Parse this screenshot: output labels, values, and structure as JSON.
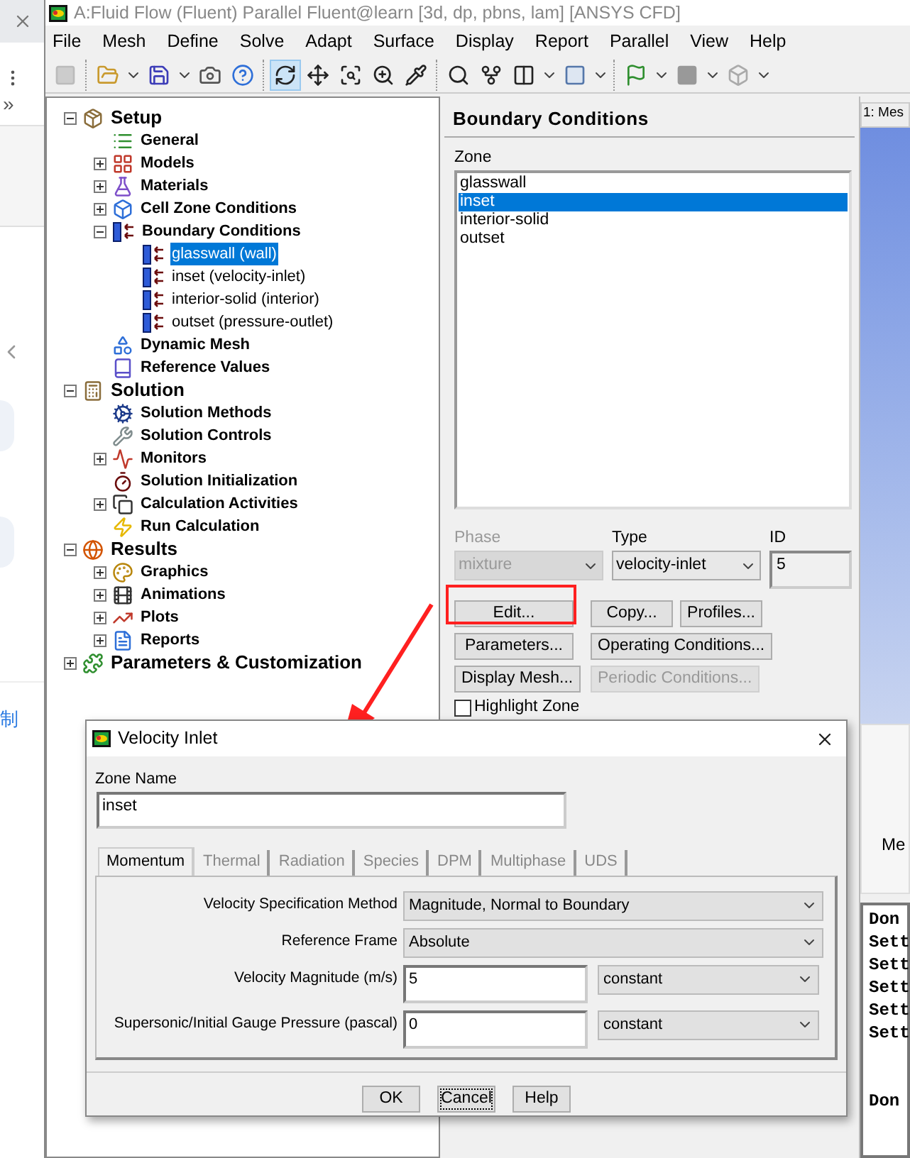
{
  "browser_strip": {
    "expand_glyph": "»",
    "link": "制"
  },
  "window": {
    "title": "A:Fluid Flow (Fluent) Parallel Fluent@learn  [3d, dp, pbns, lam] [ANSYS CFD]"
  },
  "menu": [
    "File",
    "Mesh",
    "Define",
    "Solve",
    "Adapt",
    "Surface",
    "Display",
    "Report",
    "Parallel",
    "View",
    "Help"
  ],
  "toolbar_tools": [
    {
      "selected": true
    },
    {
      "selected": false
    },
    {
      "selected": false
    },
    {
      "selected": false
    },
    {
      "selected": false
    }
  ],
  "tree": [
    {
      "label": "Setup",
      "kind": "heading",
      "selected": false,
      "expanded": true,
      "children": [
        {
          "label": "General",
          "selected": false
        },
        {
          "label": "Models",
          "selected": false,
          "expanded": false
        },
        {
          "label": "Materials",
          "selected": false,
          "expanded": false
        },
        {
          "label": "Cell Zone Conditions",
          "selected": false,
          "expanded": false
        },
        {
          "label": "Boundary Conditions",
          "selected": false,
          "expanded": true,
          "children": [
            {
              "label": "glasswall (wall)",
              "kind": "leaf",
              "selected": true
            },
            {
              "label": "inset (velocity-inlet)",
              "kind": "leaf",
              "selected": false
            },
            {
              "label": "interior-solid (interior)",
              "kind": "leaf",
              "selected": false
            },
            {
              "label": "outset (pressure-outlet)",
              "kind": "leaf",
              "selected": false
            }
          ]
        },
        {
          "label": "Dynamic Mesh",
          "selected": false
        },
        {
          "label": "Reference Values",
          "selected": false
        }
      ]
    },
    {
      "label": "Solution",
      "kind": "heading",
      "selected": false,
      "expanded": true,
      "children": [
        {
          "label": "Solution Methods",
          "selected": false
        },
        {
          "label": "Solution Controls",
          "selected": false
        },
        {
          "label": "Monitors",
          "selected": false,
          "expanded": false
        },
        {
          "label": "Solution Initialization",
          "selected": false
        },
        {
          "label": "Calculation Activities",
          "selected": false,
          "expanded": false
        },
        {
          "label": "Run Calculation",
          "selected": false
        }
      ]
    },
    {
      "label": "Results",
      "kind": "heading",
      "selected": false,
      "expanded": true,
      "children": [
        {
          "label": "Graphics",
          "selected": false,
          "expanded": false
        },
        {
          "label": "Animations",
          "selected": false,
          "expanded": false
        },
        {
          "label": "Plots",
          "selected": false,
          "expanded": false
        },
        {
          "label": "Reports",
          "selected": false,
          "expanded": false
        }
      ]
    },
    {
      "label": "Parameters & Customization",
      "kind": "heading",
      "selected": false,
      "expanded": false
    }
  ],
  "task_panel": {
    "title": "Boundary Conditions",
    "zone_label": "Zone",
    "zones": [
      {
        "label": "glasswall",
        "selected": false
      },
      {
        "label": "inset",
        "selected": true
      },
      {
        "label": "interior-solid",
        "selected": false
      },
      {
        "label": "outset",
        "selected": false
      }
    ],
    "phase": {
      "label": "Phase",
      "value": "mixture",
      "disabled": true
    },
    "type": {
      "label": "Type",
      "value": "velocity-inlet"
    },
    "id": {
      "label": "ID",
      "value": "5"
    },
    "buttons": [
      {
        "label": "Edit...",
        "disabled": false
      },
      {
        "label": "Copy...",
        "disabled": false
      },
      {
        "label": "Profiles...",
        "disabled": false
      },
      {
        "label": "Parameters...",
        "disabled": false
      },
      {
        "label": "Operating Conditions...",
        "disabled": false
      },
      {
        "label": "Display Mesh...",
        "disabled": false
      },
      {
        "label": "Periodic Conditions...",
        "disabled": true
      }
    ],
    "highlight_zone": {
      "label": "Highlight Zone",
      "checked": false
    }
  },
  "graphics": {
    "tab": "1: Mes",
    "label": "Me",
    "console": [
      "Don",
      "Sett",
      "Sett",
      "Sett",
      "Sett",
      "Sett",
      "Don"
    ]
  },
  "dialog": {
    "title": "Velocity Inlet",
    "zone_name_label": "Zone Name",
    "zone_name": "inset",
    "tabs": [
      {
        "label": "Momentum",
        "selected": true,
        "disabled": false
      },
      {
        "label": "Thermal",
        "selected": false,
        "disabled": true
      },
      {
        "label": "Radiation",
        "selected": false,
        "disabled": true
      },
      {
        "label": "Species",
        "selected": false,
        "disabled": true
      },
      {
        "label": "DPM",
        "selected": false,
        "disabled": true
      },
      {
        "label": "Multiphase",
        "selected": false,
        "disabled": true
      },
      {
        "label": "UDS",
        "selected": false,
        "disabled": true
      }
    ],
    "fields": [
      {
        "kind": "select",
        "label": "Velocity Specification Method",
        "value": "Magnitude, Normal to Boundary"
      },
      {
        "kind": "select",
        "label": "Reference Frame",
        "value": "Absolute"
      },
      {
        "kind": "number",
        "label": "Velocity Magnitude (m/s)",
        "value": "5",
        "method": "constant"
      },
      {
        "kind": "number",
        "label": "Supersonic/Initial Gauge Pressure (pascal)",
        "value": "0",
        "method": "constant"
      }
    ],
    "buttons": [
      {
        "label": "OK",
        "focused": false
      },
      {
        "label": "Cancel",
        "focused": true
      },
      {
        "label": "Help",
        "focused": false
      }
    ]
  }
}
